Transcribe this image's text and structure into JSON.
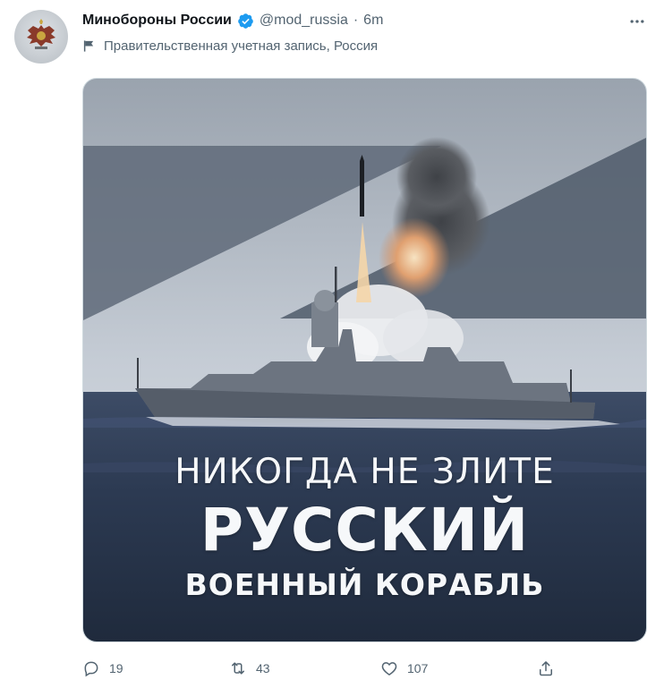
{
  "tweet": {
    "author": {
      "display_name": "Минобороны России",
      "handle": "@mod_russia",
      "verified": true,
      "avatar_icon": "double-headed-eagle-emblem"
    },
    "separator": "·",
    "time": "6m",
    "account_label": "Правительственная учетная запись, Россия",
    "label_icon": "flag-icon",
    "media": {
      "line1": "НИКОГДА НЕ ЗЛИТЕ",
      "line2": "РУССКИЙ",
      "line3": "ВОЕННЫЙ КОРАБЛЬ"
    },
    "actions": {
      "replies": "19",
      "retweets": "43",
      "likes": "107"
    }
  },
  "colors": {
    "text_primary": "#0f1419",
    "text_secondary": "#536471",
    "verified_blue": "#1d9bf0",
    "sky": "#ccd3dc",
    "sea": "#2b3a55"
  }
}
